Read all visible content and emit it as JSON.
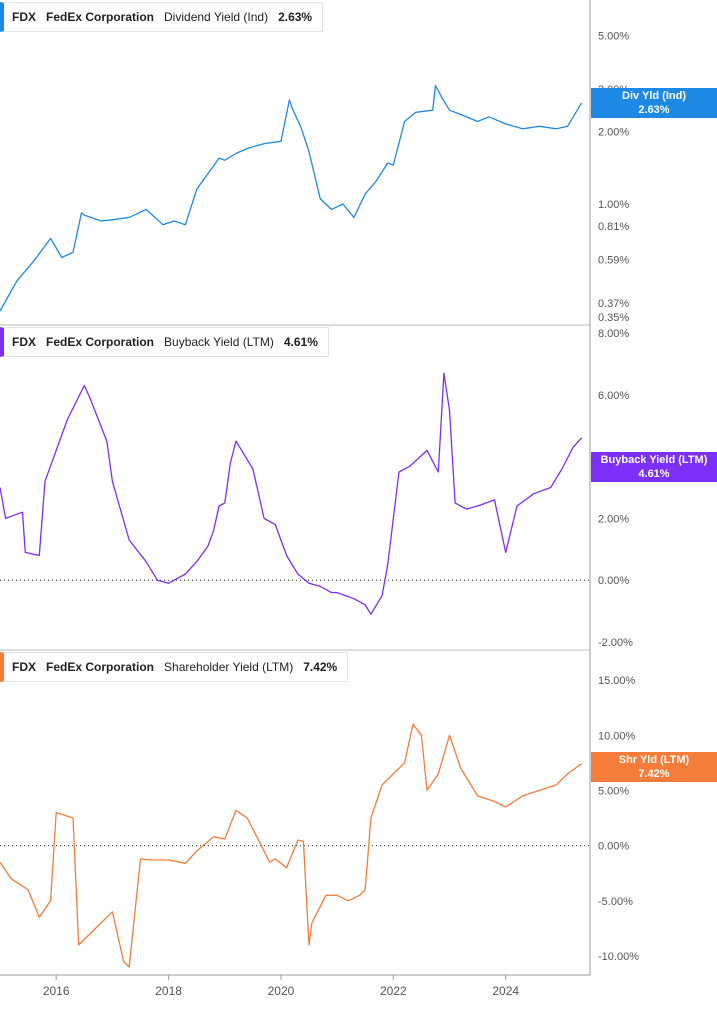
{
  "colors": {
    "div": "#1e88e5",
    "buyback": "#7b2ff7",
    "shareholder": "#f57c3b",
    "grid": "#333333",
    "axis_text": "#555555"
  },
  "x_axis": {
    "ticks": [
      "2016",
      "2018",
      "2020",
      "2022",
      "2024"
    ],
    "range": [
      2015.0,
      2025.5
    ]
  },
  "panels": [
    {
      "ticker": "FDX",
      "company": "FedEx Corporation",
      "metric": "Dividend Yield (Ind)",
      "value": "2.63%",
      "pill_line1": "Div Yld (Ind)",
      "pill_line2": "2.63%",
      "y_ticks": [
        "5.00%",
        "3.00%",
        "2.00%",
        "1.00%",
        "0.81%",
        "0.59%",
        "0.37%",
        "0.35%"
      ]
    },
    {
      "ticker": "FDX",
      "company": "FedEx Corporation",
      "metric": "Buyback Yield (LTM)",
      "value": "4.61%",
      "pill_line1": "Buyback Yield (LTM)",
      "pill_line2": "4.61%",
      "y_ticks": [
        "8.00%",
        "6.00%",
        "4.00%",
        "2.00%",
        "0.00%",
        "-2.00%"
      ]
    },
    {
      "ticker": "FDX",
      "company": "FedEx Corporation",
      "metric": "Shareholder Yield (LTM)",
      "value": "7.42%",
      "pill_line1": "Shr Yld (LTM)",
      "pill_line2": "7.42%",
      "y_ticks": [
        "15.00%",
        "10.00%",
        "5.00%",
        "0.00%",
        "-5.00%",
        "-10.00%"
      ]
    }
  ],
  "chart_data": [
    {
      "type": "line",
      "title": "FDX FedEx Corporation Dividend Yield (Ind) 2.63%",
      "y_scale": "log",
      "ylim": [
        0.34,
        6.5
      ],
      "series": [
        {
          "name": "Div Yld (Ind)",
          "x": [
            2015.0,
            2015.3,
            2015.6,
            2015.9,
            2016.1,
            2016.3,
            2016.45,
            2016.5,
            2016.8,
            2017.0,
            2017.3,
            2017.6,
            2017.9,
            2018.1,
            2018.3,
            2018.5,
            2018.9,
            2019.0,
            2019.2,
            2019.4,
            2019.7,
            2020.0,
            2020.15,
            2020.2,
            2020.35,
            2020.5,
            2020.7,
            2020.9,
            2021.1,
            2021.3,
            2021.5,
            2021.7,
            2021.9,
            2022.0,
            2022.2,
            2022.4,
            2022.7,
            2022.75,
            2022.85,
            2023.0,
            2023.2,
            2023.5,
            2023.7,
            2024.0,
            2024.3,
            2024.6,
            2024.9,
            2025.1,
            2025.25,
            2025.35
          ],
          "values": [
            0.36,
            0.48,
            0.58,
            0.72,
            0.6,
            0.63,
            0.92,
            0.9,
            0.85,
            0.86,
            0.88,
            0.95,
            0.82,
            0.85,
            0.82,
            1.15,
            1.55,
            1.52,
            1.62,
            1.7,
            1.78,
            1.82,
            2.7,
            2.5,
            2.1,
            1.65,
            1.05,
            0.95,
            1.0,
            0.88,
            1.1,
            1.25,
            1.48,
            1.45,
            2.2,
            2.4,
            2.45,
            3.1,
            2.8,
            2.45,
            2.35,
            2.2,
            2.3,
            2.15,
            2.05,
            2.1,
            2.05,
            2.1,
            2.4,
            2.63
          ]
        }
      ]
    },
    {
      "type": "line",
      "title": "FDX FedEx Corporation Buyback Yield (LTM) 4.61%",
      "ylim": [
        -2.0,
        8.0
      ],
      "series": [
        {
          "name": "Buyback Yield (LTM)",
          "x": [
            2015.0,
            2015.1,
            2015.4,
            2015.45,
            2015.7,
            2015.8,
            2016.2,
            2016.5,
            2016.6,
            2016.9,
            2017.0,
            2017.3,
            2017.6,
            2017.8,
            2018.0,
            2018.3,
            2018.5,
            2018.7,
            2018.8,
            2018.9,
            2019.0,
            2019.1,
            2019.2,
            2019.5,
            2019.7,
            2019.9,
            2020.1,
            2020.3,
            2020.5,
            2020.7,
            2020.9,
            2021.0,
            2021.3,
            2021.5,
            2021.6,
            2021.8,
            2021.9,
            2022.1,
            2022.3,
            2022.6,
            2022.8,
            2022.9,
            2023.0,
            2023.1,
            2023.3,
            2023.5,
            2023.8,
            2024.0,
            2024.2,
            2024.5,
            2024.8,
            2025.0,
            2025.2,
            2025.35
          ],
          "values": [
            3.0,
            2.0,
            2.2,
            0.9,
            0.8,
            3.2,
            5.2,
            6.3,
            5.9,
            4.5,
            3.2,
            1.3,
            0.6,
            0.0,
            -0.1,
            0.2,
            0.6,
            1.1,
            1.6,
            2.4,
            2.5,
            3.8,
            4.5,
            3.6,
            2.0,
            1.8,
            0.8,
            0.2,
            -0.1,
            -0.2,
            -0.4,
            -0.4,
            -0.6,
            -0.8,
            -1.1,
            -0.5,
            0.5,
            3.5,
            3.7,
            4.2,
            3.5,
            6.7,
            5.5,
            2.5,
            2.3,
            2.4,
            2.6,
            0.9,
            2.4,
            2.8,
            3.0,
            3.6,
            4.3,
            4.61
          ]
        }
      ]
    },
    {
      "type": "line",
      "title": "FDX FedEx Corporation Shareholder Yield (LTM) 7.42%",
      "ylim": [
        -11.0,
        17.0
      ],
      "series": [
        {
          "name": "Shr Yld (LTM)",
          "x": [
            2015.0,
            2015.2,
            2015.5,
            2015.7,
            2015.9,
            2016.0,
            2016.3,
            2016.4,
            2016.6,
            2016.8,
            2017.0,
            2017.2,
            2017.3,
            2017.5,
            2017.7,
            2018.0,
            2018.3,
            2018.5,
            2018.8,
            2019.0,
            2019.2,
            2019.4,
            2019.6,
            2019.8,
            2019.9,
            2020.1,
            2020.3,
            2020.4,
            2020.5,
            2020.55,
            2020.8,
            2021.0,
            2021.2,
            2021.4,
            2021.5,
            2021.6,
            2021.8,
            2022.0,
            2022.2,
            2022.35,
            2022.5,
            2022.6,
            2022.8,
            2023.0,
            2023.2,
            2023.5,
            2023.8,
            2024.0,
            2024.3,
            2024.6,
            2024.9,
            2025.1,
            2025.35
          ],
          "values": [
            -1.5,
            -3.0,
            -4.0,
            -6.5,
            -5.0,
            3.0,
            2.5,
            -9.0,
            -8.0,
            -7.0,
            -6.0,
            -10.5,
            -11.0,
            -1.2,
            -1.3,
            -1.3,
            -1.6,
            -0.5,
            0.8,
            0.6,
            3.2,
            2.5,
            0.5,
            -1.5,
            -1.2,
            -2.0,
            0.5,
            0.4,
            -9.0,
            -7.0,
            -4.5,
            -4.5,
            -5.0,
            -4.5,
            -4.0,
            2.5,
            5.5,
            6.5,
            7.5,
            11.0,
            10.0,
            5.0,
            6.5,
            10.0,
            7.0,
            4.5,
            4.0,
            3.5,
            4.5,
            5.0,
            5.5,
            6.5,
            7.42
          ]
        }
      ]
    }
  ]
}
